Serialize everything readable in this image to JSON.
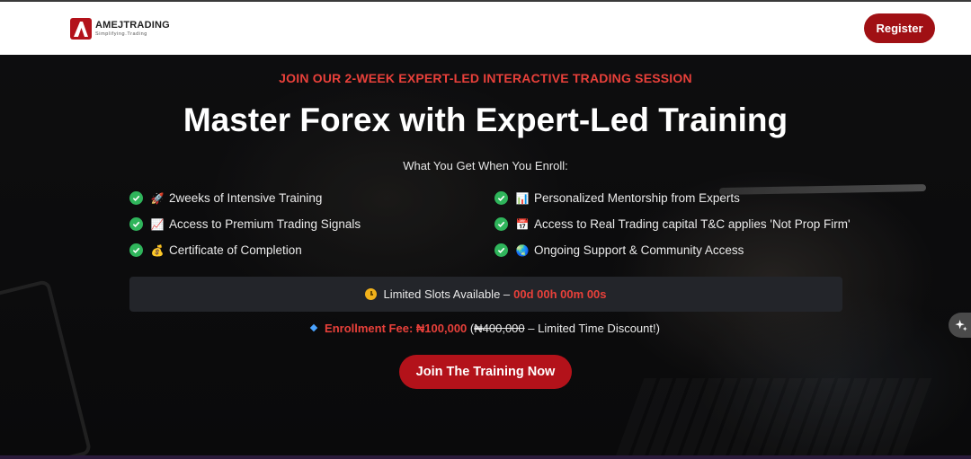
{
  "brand": {
    "name": "AMEJTRADING",
    "tagline": "Simplifying.Trading",
    "accent_color": "#a01014"
  },
  "nav": {
    "register_label": "Register"
  },
  "hero": {
    "eyebrow": "JOIN OUR 2-WEEK EXPERT-LED INTERACTIVE TRADING SESSION",
    "headline": "Master Forex with Expert-Led Training",
    "subhead": "What You Get When You Enroll:",
    "features_left": [
      {
        "icon": "rocket-icon",
        "emoji": "🚀",
        "text": "2weeks of Intensive Training"
      },
      {
        "icon": "chart-increasing-icon",
        "emoji": "📈",
        "text": "Access to Premium Trading Signals"
      },
      {
        "icon": "money-bag-icon",
        "emoji": "💰",
        "text": "Certificate of Completion"
      }
    ],
    "features_right": [
      {
        "icon": "bar-chart-icon",
        "emoji": "📊",
        "text": "Personalized Mentorship from Experts"
      },
      {
        "icon": "calendar-icon",
        "emoji": "📅",
        "text": "Access to Real Trading capital T&C applies 'Not Prop Firm'"
      },
      {
        "icon": "globe-icon",
        "emoji": "🌏",
        "text": "Ongoing Support & Community Access"
      }
    ],
    "countdown": {
      "label": "Limited Slots Available –",
      "time": "00d 00h 00m 00s"
    },
    "fee": {
      "label": "Enrollment Fee:",
      "amount": "₦100,000",
      "open_paren": "(",
      "old_amount": "₦400,000",
      "note": "– Limited Time Discount!)"
    },
    "cta_label": "Join The Training Now"
  },
  "colors": {
    "check_green": "#2fb55b",
    "highlight_red": "#e8403a",
    "button_red": "#b3121a"
  }
}
